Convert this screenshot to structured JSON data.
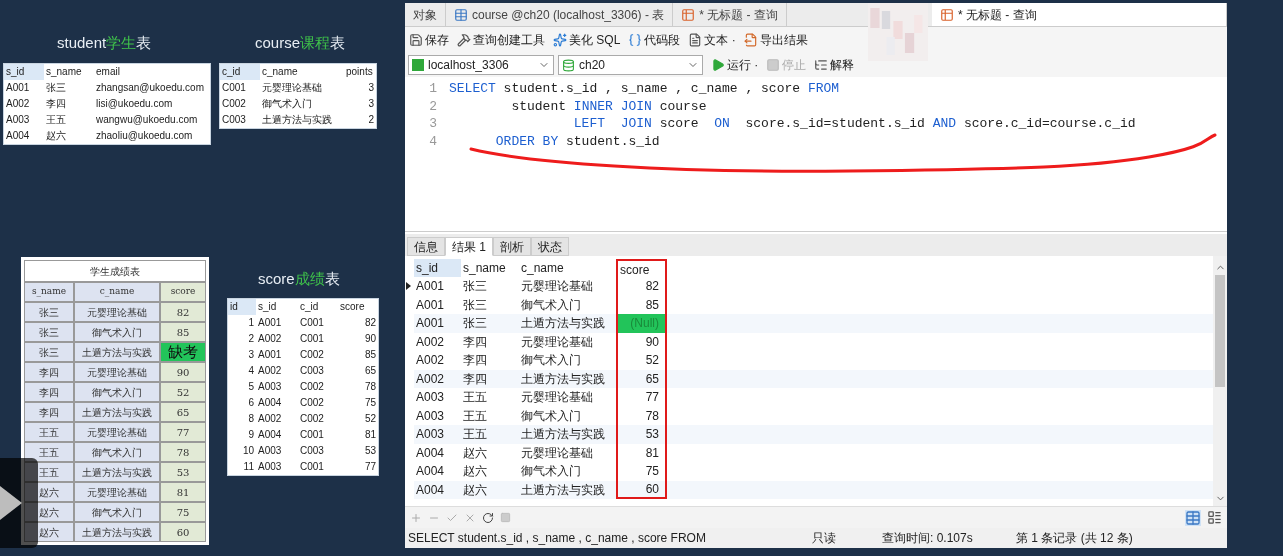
{
  "slide": {
    "student_table": {
      "title_en": "student",
      "title_zh": "学生",
      "title_suffix": "表",
      "columns": [
        "s_id",
        "s_name",
        "email"
      ],
      "rows": [
        [
          "A001",
          "张三",
          "zhangsan@ukoedu.com"
        ],
        [
          "A002",
          "李四",
          "lisi@ukoedu.com"
        ],
        [
          "A003",
          "王五",
          "wangwu@ukoedu.com"
        ],
        [
          "A004",
          "赵六",
          "zhaoliu@ukoedu.com"
        ]
      ]
    },
    "course_table": {
      "title_en": "course",
      "title_zh": "课程",
      "title_suffix": "表",
      "columns": [
        "c_id",
        "c_name",
        "points"
      ],
      "rows": [
        [
          "C001",
          "元婴理论基础",
          "3"
        ],
        [
          "C002",
          "御气术入门",
          "3"
        ],
        [
          "C003",
          "土遁方法与实践",
          "2"
        ]
      ]
    },
    "report_table": {
      "title": "学生成绩表",
      "columns": [
        "s_name",
        "c_name",
        "score"
      ],
      "rows": [
        {
          "cells": [
            "张三",
            "元婴理论基础",
            "82"
          ],
          "absent": false
        },
        {
          "cells": [
            "张三",
            "御气术入门",
            "85"
          ],
          "absent": false
        },
        {
          "cells": [
            "张三",
            "土遁方法与实践",
            "缺考"
          ],
          "absent": true
        },
        {
          "cells": [
            "李四",
            "元婴理论基础",
            "90"
          ],
          "absent": false
        },
        {
          "cells": [
            "李四",
            "御气术入门",
            "52"
          ],
          "absent": false
        },
        {
          "cells": [
            "李四",
            "土遁方法与实践",
            "65"
          ],
          "absent": false
        },
        {
          "cells": [
            "王五",
            "元婴理论基础",
            "77"
          ],
          "absent": false
        },
        {
          "cells": [
            "王五",
            "御气术入门",
            "78"
          ],
          "absent": false
        },
        {
          "cells": [
            "王五",
            "土遁方法与实践",
            "53"
          ],
          "absent": false
        },
        {
          "cells": [
            "赵六",
            "元婴理论基础",
            "81"
          ],
          "absent": false
        },
        {
          "cells": [
            "赵六",
            "御气术入门",
            "75"
          ],
          "absent": false
        },
        {
          "cells": [
            "赵六",
            "土遁方法与实践",
            "60"
          ],
          "absent": false
        }
      ]
    },
    "score_table": {
      "title_en": "score",
      "title_zh": "成绩",
      "title_suffix": "表",
      "columns": [
        "id",
        "s_id",
        "c_id",
        "score"
      ],
      "rows": [
        [
          "1",
          "A001",
          "C001",
          "82"
        ],
        [
          "2",
          "A002",
          "C001",
          "90"
        ],
        [
          "3",
          "A001",
          "C002",
          "85"
        ],
        [
          "4",
          "A002",
          "C003",
          "65"
        ],
        [
          "5",
          "A003",
          "C002",
          "78"
        ],
        [
          "6",
          "A004",
          "C002",
          "75"
        ],
        [
          "8",
          "A002",
          "C002",
          "52"
        ],
        [
          "9",
          "A004",
          "C001",
          "81"
        ],
        [
          "10",
          "A003",
          "C003",
          "53"
        ],
        [
          "11",
          "A003",
          "C001",
          "77"
        ]
      ]
    }
  },
  "window": {
    "tabs": [
      {
        "label": "对象",
        "kind": "plain",
        "selected": false
      },
      {
        "label": "course @ch20 (localhost_3306) - 表",
        "kind": "table",
        "selected": false
      },
      {
        "label": "* 无标题 - 查询",
        "kind": "query",
        "selected": false
      },
      {
        "label": "* 无标题 - 查询",
        "kind": "query",
        "selected": true
      }
    ],
    "toolbar": [
      {
        "label": "保存",
        "kind": "save"
      },
      {
        "label": "查询创建工具",
        "kind": "builder"
      },
      {
        "label": "美化 SQL",
        "kind": "beautify"
      },
      {
        "label": "代码段",
        "kind": "snippet"
      },
      {
        "label": "文本 ·",
        "kind": "text"
      },
      {
        "label": "导出结果",
        "kind": "export"
      }
    ],
    "connection": "localhost_3306",
    "database": "ch20",
    "run_controls": [
      {
        "label": "运行 ·",
        "kind": "run",
        "disabled": false
      },
      {
        "label": "停止",
        "kind": "stop",
        "disabled": true
      },
      {
        "label": "解释",
        "kind": "explain",
        "disabled": false
      }
    ],
    "editor": {
      "lines": [
        {
          "number": "1",
          "tokens": [
            {
              "text": "SELECT",
              "kind": "keyword"
            },
            {
              "text": " student.s_id , s_name , c_name , score ",
              "kind": "plain"
            },
            {
              "text": "FROM",
              "kind": "keyword"
            }
          ]
        },
        {
          "number": "2",
          "tokens": [
            {
              "text": "        student ",
              "kind": "plain"
            },
            {
              "text": "INNER JOIN",
              "kind": "keyword"
            },
            {
              "text": " course",
              "kind": "plain"
            }
          ]
        },
        {
          "number": "3",
          "tokens": [
            {
              "text": "                LEFT  JOIN",
              "kind": "keyword"
            },
            {
              "text": " score  ",
              "kind": "plain"
            },
            {
              "text": "ON",
              "kind": "keyword"
            },
            {
              "text": "  score.s_id=student.s_id ",
              "kind": "plain"
            },
            {
              "text": "AND",
              "kind": "keyword"
            },
            {
              "text": " score.c_id=course.c_id",
              "kind": "plain"
            }
          ]
        },
        {
          "number": "4",
          "tokens": [
            {
              "text": "      ORDER BY",
              "kind": "keyword"
            },
            {
              "text": " student.s_id",
              "kind": "plain"
            }
          ]
        }
      ]
    },
    "result_tabs": [
      {
        "label": "信息",
        "selected": false
      },
      {
        "label": "结果 1",
        "selected": true
      },
      {
        "label": "剖析",
        "selected": false
      },
      {
        "label": "状态",
        "selected": false
      }
    ],
    "grid": {
      "columns": [
        "s_id",
        "s_name",
        "c_name",
        "score"
      ],
      "rows": [
        {
          "cells": [
            "A001",
            "张三",
            "元婴理论基础",
            "82"
          ],
          "current": true,
          "highlighted": false
        },
        {
          "cells": [
            "A001",
            "张三",
            "御气术入门",
            "85"
          ],
          "current": false,
          "highlighted": false
        },
        {
          "cells": [
            "A001",
            "张三",
            "土遁方法与实践",
            "(Null)"
          ],
          "current": false,
          "highlighted": true
        },
        {
          "cells": [
            "A002",
            "李四",
            "元婴理论基础",
            "90"
          ],
          "current": false,
          "highlighted": false
        },
        {
          "cells": [
            "A002",
            "李四",
            "御气术入门",
            "52"
          ],
          "current": false,
          "highlighted": false
        },
        {
          "cells": [
            "A002",
            "李四",
            "土遁方法与实践",
            "65"
          ],
          "current": false,
          "highlighted": false
        },
        {
          "cells": [
            "A003",
            "王五",
            "元婴理论基础",
            "77"
          ],
          "current": false,
          "highlighted": false
        },
        {
          "cells": [
            "A003",
            "王五",
            "御气术入门",
            "78"
          ],
          "current": false,
          "highlighted": false
        },
        {
          "cells": [
            "A003",
            "王五",
            "土遁方法与实践",
            "53"
          ],
          "current": false,
          "highlighted": false
        },
        {
          "cells": [
            "A004",
            "赵六",
            "元婴理论基础",
            "81"
          ],
          "current": false,
          "highlighted": false
        },
        {
          "cells": [
            "A004",
            "赵六",
            "御气术入门",
            "75"
          ],
          "current": false,
          "highlighted": false
        },
        {
          "cells": [
            "A004",
            "赵六",
            "土遁方法与实践",
            "60"
          ],
          "current": false,
          "highlighted": false
        }
      ]
    },
    "status_bar": {
      "sql": "SELECT student.s_id , s_name , c_name , score FROM",
      "mode": "只读",
      "time": "查询时间: 0.107s",
      "record": "第 1 条记录 (共 12 条)"
    }
  }
}
